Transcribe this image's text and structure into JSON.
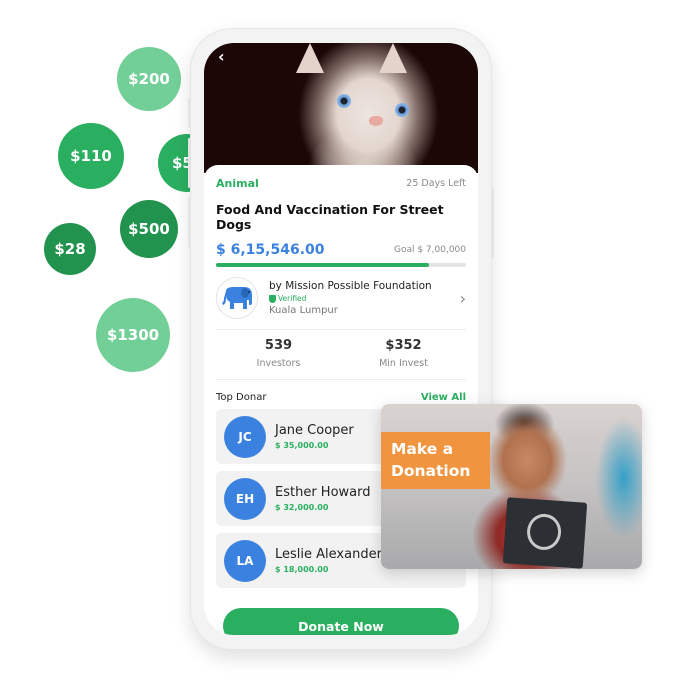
{
  "bubbles": [
    {
      "label": "$200",
      "shade": "light"
    },
    {
      "label": "$110",
      "shade": "mid"
    },
    {
      "label": "$5",
      "shade": "mid"
    },
    {
      "label": "$500",
      "shade": "dark"
    },
    {
      "label": "$28",
      "shade": "dark"
    },
    {
      "label": "$1300",
      "shade": "light"
    }
  ],
  "hero": {
    "back_icon": "‹"
  },
  "campaign": {
    "category": "Animal",
    "days_left": "25 Days Left",
    "title": "Food And Vaccination For Street Dogs",
    "raised": "$ 6,15,546.00",
    "goal": "Goal $ 7,00,000",
    "progress_fraction": 0.85
  },
  "organization": {
    "name": "by Mission Possible Foundation",
    "verified_label": "Verified",
    "location": "Kuala Lumpur",
    "chevron": "›"
  },
  "stats": [
    {
      "value": "539",
      "label": "Investors"
    },
    {
      "value": "$352",
      "label": "Min Invest"
    }
  ],
  "donors": {
    "title": "Top Donar",
    "view_all": "View All",
    "items": [
      {
        "initials": "JC",
        "name": "Jane Cooper",
        "amount": "$ 35,000.00"
      },
      {
        "initials": "EH",
        "name": "Esther Howard",
        "amount": "$ 32,000.00"
      },
      {
        "initials": "LA",
        "name": "Leslie Alexander",
        "amount": "$ 18,000.00"
      }
    ]
  },
  "donate_button": "Donate Now",
  "promo": {
    "line1": "Make a",
    "line2": "Donation"
  },
  "colors": {
    "brand_green": "#2aaf60",
    "accent_blue": "#3b82e0",
    "promo_orange": "#f0943f"
  }
}
